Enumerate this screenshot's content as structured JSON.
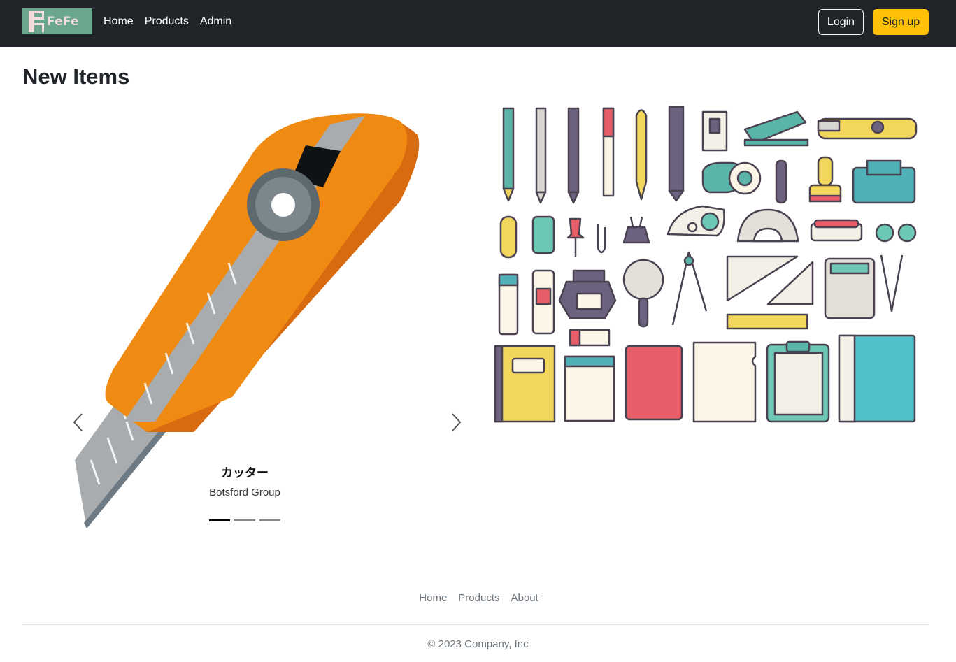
{
  "navbar": {
    "brand": "FeFe",
    "brand_letter": "F",
    "links": [
      "Home",
      "Products",
      "Admin"
    ],
    "login_label": "Login",
    "signup_label": "Sign up"
  },
  "main": {
    "title": "New Items",
    "carousel": {
      "caption_title": "カッター",
      "caption_subtitle": "Botsford Group",
      "slide_count": 3,
      "active_slide": 1
    }
  },
  "footer": {
    "links": [
      "Home",
      "Products",
      "About"
    ],
    "copyright": "© 2023 Company, Inc"
  },
  "colors": {
    "navbar_bg": "#212529",
    "brand_bg": "#6aa58d",
    "signup_bg": "#ffc107",
    "cutter_orange": "#ef8a12",
    "cutter_blade": "#a8acaf"
  }
}
